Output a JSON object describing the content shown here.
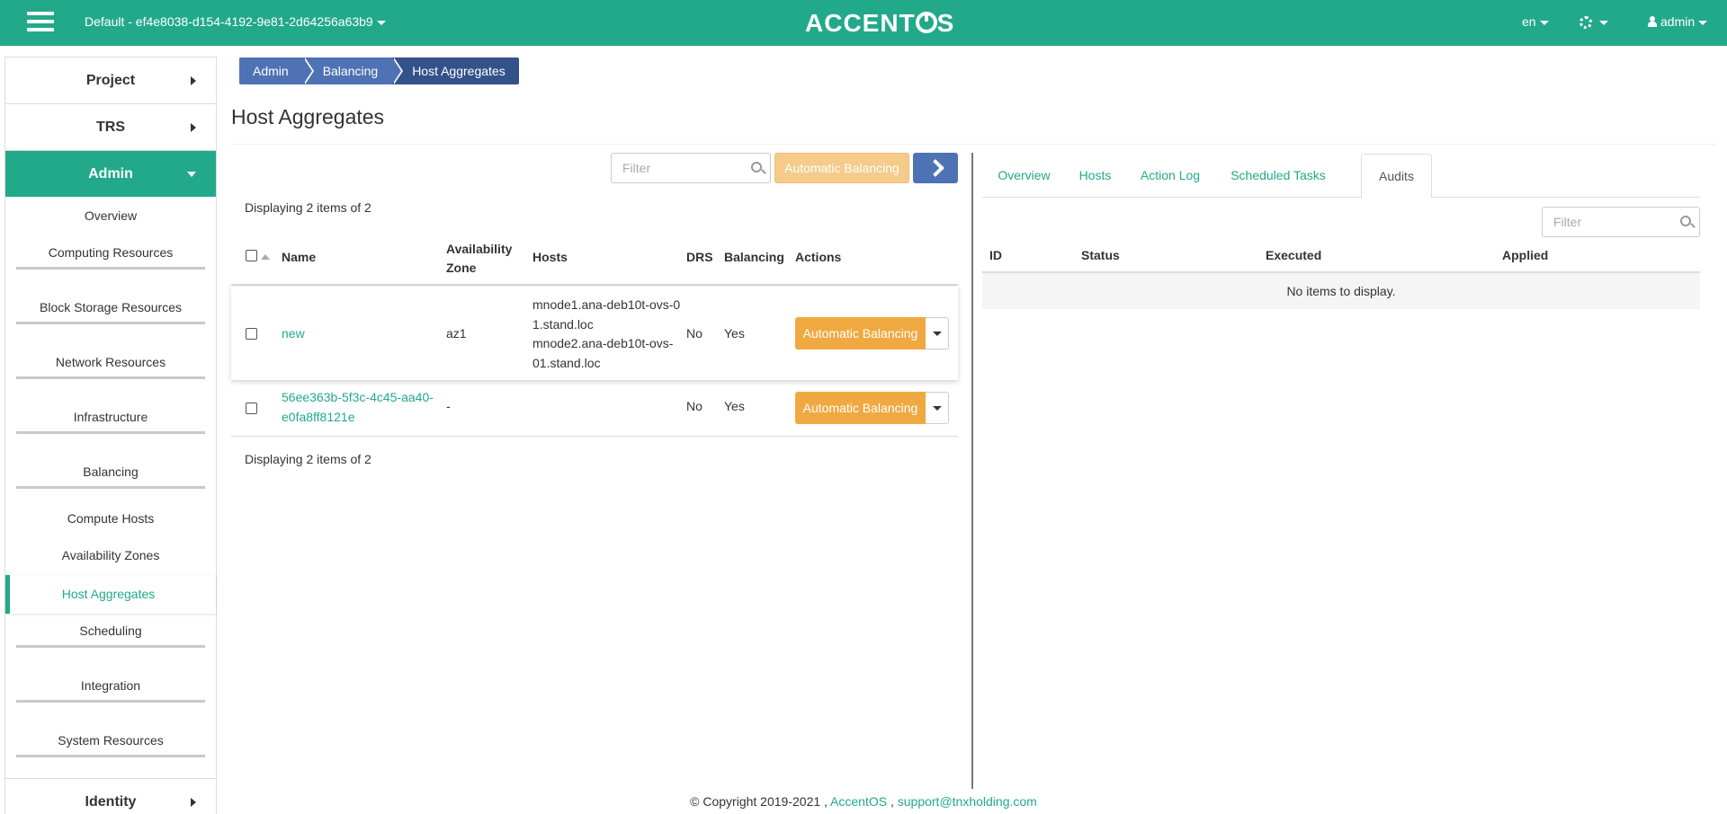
{
  "header": {
    "project": "Default - ef4e8038-d154-4192-9e81-2d64256a63b9",
    "logo_text": "ACCENTOS",
    "language": "en",
    "user": "admin",
    "brand_color": "#22a98a"
  },
  "sidebar": {
    "project": "Project",
    "trs": "TRS",
    "admin": "Admin",
    "items": [
      "Overview",
      "Computing Resources",
      "Block Storage Resources",
      "Network Resources",
      "Infrastructure",
      "Balancing",
      "Compute Hosts",
      "Availability Zones",
      "Host Aggregates",
      "Scheduling",
      "Integration",
      "System Resources"
    ],
    "identity": "Identity"
  },
  "breadcrumb": [
    "Admin",
    "Balancing",
    "Host Aggregates"
  ],
  "page_title": "Host Aggregates",
  "left": {
    "filter_placeholder": "Filter",
    "auto_button": "Automatic Balancing",
    "count_top": "Displaying 2 items of 2",
    "count_bottom": "Displaying 2 items of 2",
    "columns": {
      "name": "Name",
      "zone_line1": "Availability",
      "zone_line2": "Zone",
      "hosts": "Hosts",
      "drs": "DRS",
      "balancing": "Balancing",
      "actions": "Actions"
    },
    "rows": [
      {
        "name": "new",
        "zone": "az1",
        "hosts_lines": [
          "mnode1.ana-deb10t-ovs-0",
          "1.stand.loc",
          "mnode2.ana-deb10t-ovs-",
          "01.stand.loc"
        ],
        "drs": "No",
        "balancing": "Yes",
        "action": "Automatic Balancing"
      },
      {
        "name_lines": [
          "56ee363b-5f3c-4c45-aa40-",
          "e0fa8ff8121e"
        ],
        "zone": "-",
        "drs": "No",
        "balancing": "Yes",
        "action": "Automatic Balancing"
      }
    ]
  },
  "right": {
    "tabs": [
      "Overview",
      "Hosts",
      "Action Log",
      "Scheduled Tasks",
      "Audits"
    ],
    "filter_placeholder": "Filter",
    "columns": [
      "ID",
      "Status",
      "Executed",
      "Applied"
    ],
    "empty": "No items to display."
  },
  "footer": {
    "copyright": "© Copyright 2019-2021 ,",
    "brand_link": "AccentOS",
    "sep": ",",
    "email": "support@tnxholding.com"
  }
}
